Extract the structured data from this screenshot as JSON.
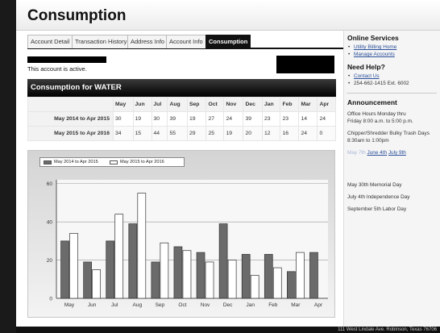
{
  "page": {
    "title": "Consumption"
  },
  "tabs": [
    {
      "label": "Account Detail"
    },
    {
      "label": "Transaction History"
    },
    {
      "label": "Address Info"
    },
    {
      "label": "Account Info"
    },
    {
      "label": "Consumption"
    }
  ],
  "account": {
    "status_text": "This account is active."
  },
  "section": {
    "title": "Consumption for WATER"
  },
  "table": {
    "months": [
      "May",
      "Jun",
      "Jul",
      "Aug",
      "Sep",
      "Oct",
      "Nov",
      "Dec",
      "Jan",
      "Feb",
      "Mar",
      "Apr"
    ],
    "rows": [
      {
        "label": "May 2014 to Apr 2015",
        "values": [
          "30",
          "19",
          "30",
          "39",
          "19",
          "27",
          "24",
          "39",
          "23",
          "23",
          "14",
          "24"
        ]
      },
      {
        "label": "May 2015 to Apr 2016",
        "values": [
          "34",
          "15",
          "44",
          "55",
          "29",
          "25",
          "19",
          "20",
          "12",
          "16",
          "24",
          "0"
        ]
      }
    ]
  },
  "chart_data": {
    "type": "bar",
    "categories": [
      "May",
      "Jun",
      "Jul",
      "Aug",
      "Sep",
      "Oct",
      "Nov",
      "Dec",
      "Jan",
      "Feb",
      "Mar",
      "Apr"
    ],
    "series": [
      {
        "name": "May 2014 to Apr 2015",
        "values": [
          30,
          19,
          30,
          39,
          19,
          27,
          24,
          39,
          23,
          23,
          14,
          24
        ],
        "color": "#6b6b6b"
      },
      {
        "name": "May 2015 to Apr 2016",
        "values": [
          34,
          15,
          44,
          55,
          29,
          25,
          19,
          20,
          12,
          16,
          24,
          0
        ],
        "color": "#ffffff"
      }
    ],
    "yticks": [
      0,
      20,
      40,
      60
    ],
    "ylim": [
      0,
      62
    ],
    "grid": true,
    "legend_position": "top-left"
  },
  "sidebar": {
    "online_services": {
      "title": "Online Services",
      "links": [
        "Utility Billing Home",
        "Manage Accounts"
      ]
    },
    "need_help": {
      "title": "Need Help?",
      "contact_label": "Contact Us",
      "phone": "254-662-1415 Ext. 6002"
    },
    "announcement": {
      "title": "Announcement",
      "lines": [
        "Office Hours Monday thru",
        "Friday 8:00 a.m. to 5:00 p.m.",
        "Chipper/Shredder Bulky Trash Days",
        "8:30am to 1:00pm"
      ],
      "dates_faded": "May 7th",
      "dates_link_1": "June 4th",
      "dates_link_2": "July 9th",
      "holidays": [
        "May 30th Memorial Day",
        "July 4th  Independence Day",
        "September 5th Labor Day"
      ]
    }
  },
  "footer": {
    "text": "111 West Lindale Ave. Robinson, Texas 76706"
  },
  "colors": {
    "series_1": "#6b6b6b",
    "series_2": "#ffffff",
    "header_bar": "#000000",
    "link": "#2a4e9a"
  }
}
